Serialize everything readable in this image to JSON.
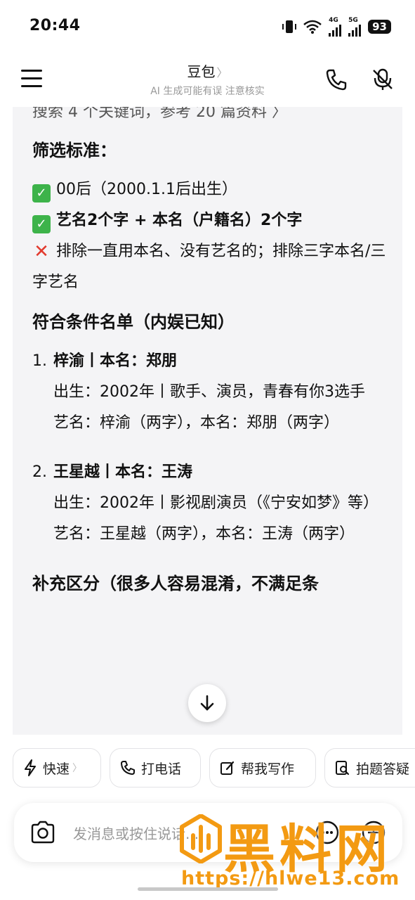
{
  "status_bar": {
    "time": "20:44",
    "net1": "4G",
    "net2": "5G",
    "battery": "93"
  },
  "header": {
    "title": "豆包",
    "title_chevron": "〉",
    "subtitle": "AI 生成可能有误 注意核实"
  },
  "content": {
    "cut_line": "搜索 4 个关键词，参考 20 篇资料 〉",
    "section1_title": "筛选标准：",
    "criteria": [
      {
        "mark": "check",
        "text": "00后（2000.1.1后出生）",
        "bold": false
      },
      {
        "mark": "check",
        "text": "艺名2个字 + 本名（户籍名）2个字",
        "bold": true
      },
      {
        "mark": "cross",
        "text": "排除一直用本名、没有艺名的；排除三字本名/三字艺名",
        "bold": false
      }
    ],
    "section2_title": "符合条件名单（内娱已知）",
    "entries": [
      {
        "num": "1.",
        "head": "梓渝丨本名：郑朋",
        "line1": "出生：2002年丨歌手、演员，青春有你3选手",
        "line2": "艺名：梓渝（两字），本名：郑朋（两字）"
      },
      {
        "num": "2.",
        "head": "王星越丨本名：王涛",
        "line1": "出生：2002年丨影视剧演员（《宁安如梦》等）",
        "line2": "艺名：王星越（两字），本名：王涛（两字）"
      }
    ],
    "section3_title": "补充区分（很多人容易混淆，不满足条"
  },
  "chips": [
    {
      "label": "快速",
      "icon": "lightning-icon",
      "chevron": "〉"
    },
    {
      "label": "打电话",
      "icon": "phone-icon"
    },
    {
      "label": "帮我写作",
      "icon": "edit-icon"
    },
    {
      "label": "拍题答疑",
      "icon": "search-doc-icon"
    }
  ],
  "input": {
    "placeholder": "发消息或按住说话..."
  },
  "watermark": {
    "logo_text": "黑料网",
    "url": "https://hlwe13.com"
  },
  "colors": {
    "content_bg": "#f4f4f6",
    "check": "#3db34a",
    "cross": "#e23a2e",
    "watermark": "#f39a12"
  }
}
